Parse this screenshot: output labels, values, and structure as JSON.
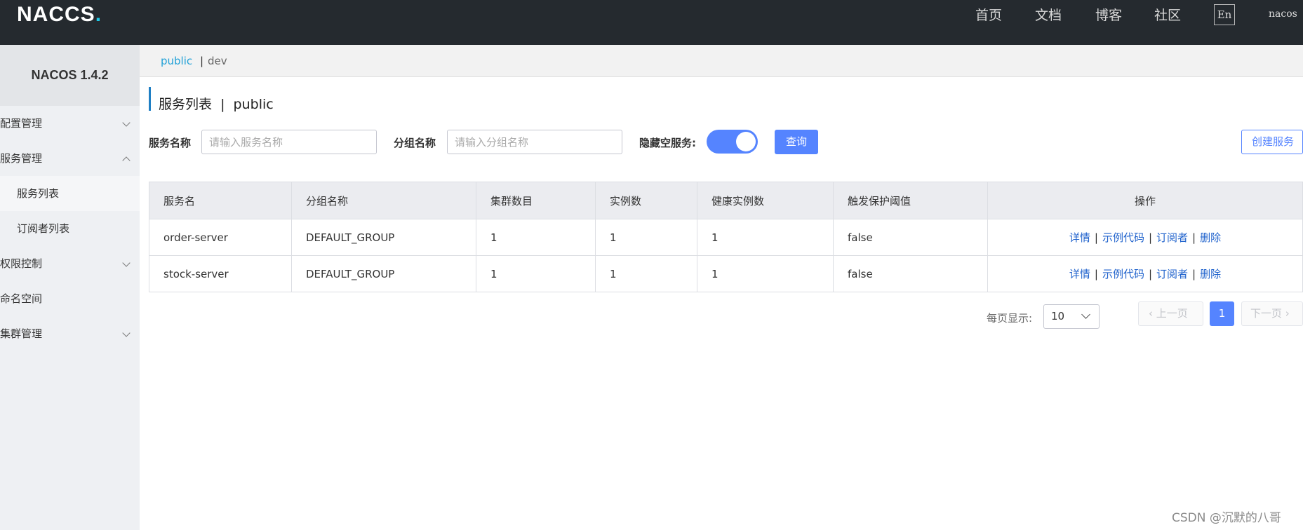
{
  "header": {
    "logo": "NAC",
    "logo_o": "O",
    "logo_s": "S",
    "logo_dot": ".",
    "nav": [
      "首页",
      "文档",
      "博客",
      "社区"
    ],
    "lang_button": "En",
    "user": "nacos"
  },
  "sidebar": {
    "title": "NACOS 1.4.2",
    "items": [
      {
        "label": "配置管理",
        "expanded": false
      },
      {
        "label": "服务管理",
        "expanded": true
      },
      {
        "label": "服务列表",
        "active": true
      },
      {
        "label": "订阅者列表"
      },
      {
        "label": "权限控制",
        "expanded": false
      },
      {
        "label": "命名空间"
      },
      {
        "label": "集群管理",
        "expanded": false
      }
    ]
  },
  "namespaces": {
    "active": "public",
    "separator": "|",
    "other": "dev"
  },
  "page": {
    "title": "服务列表  |  public"
  },
  "search": {
    "service_label": "服务名称",
    "service_placeholder": "请输入服务名称",
    "group_label": "分组名称",
    "group_placeholder": "请输入分组名称",
    "hide_empty_label": "隐藏空服务:",
    "hide_empty_on": true,
    "query_button": "查询",
    "create_button": "创建服务"
  },
  "table": {
    "headers": [
      "服务名",
      "分组名称",
      "集群数目",
      "实例数",
      "健康实例数",
      "触发保护阈值",
      "操作"
    ],
    "rows": [
      {
        "name": "order-server",
        "group": "DEFAULT_GROUP",
        "clusters": "1",
        "instances": "1",
        "healthy": "1",
        "threshold": "false"
      },
      {
        "name": "stock-server",
        "group": "DEFAULT_GROUP",
        "clusters": "1",
        "instances": "1",
        "healthy": "1",
        "threshold": "false"
      }
    ],
    "actions": {
      "detail": "详情",
      "sample": "示例代码",
      "subscribers": "订阅者",
      "delete": "删除",
      "sep": "|"
    }
  },
  "pagination": {
    "per_page_label": "每页显示:",
    "per_page": "10",
    "prev": "上一页",
    "current": "1",
    "next": "下一页"
  },
  "watermark": "CSDN @沉默的八哥",
  "colors": {
    "primary": "#5584ff",
    "link": "#1f62cc",
    "header_bg": "#252a2f",
    "ns_active": "#21a1d7"
  }
}
